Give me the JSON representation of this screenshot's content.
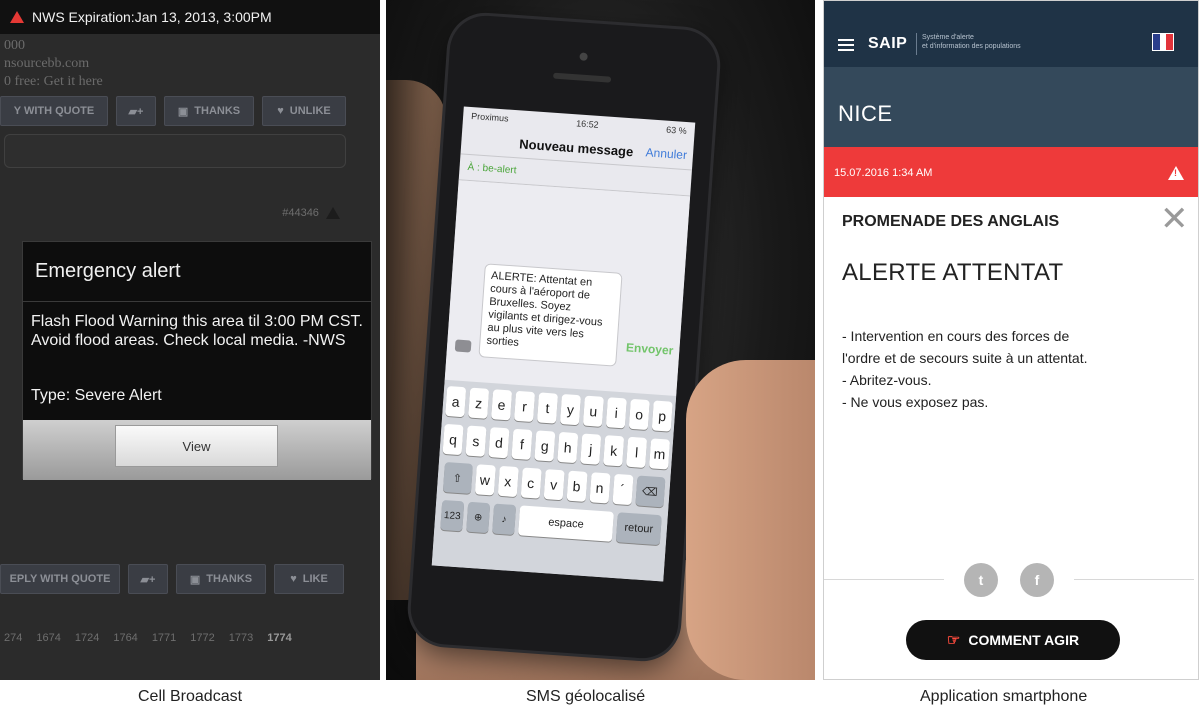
{
  "captions": {
    "left": "Cell Broadcast",
    "middle": "SMS géolocalisé",
    "right": "Application smartphone"
  },
  "cell_broadcast": {
    "status_text": "NWS  Expiration:Jan 13, 2013, 3:00PM",
    "forum_lines": [
      "000",
      "nsourcebb.com",
      "0 free: Get it here"
    ],
    "buttons_top": [
      "Y WITH QUOTE",
      "THANKS",
      "UNLIKE"
    ],
    "buttons_bottom": [
      "EPLY WITH QUOTE",
      "THANKS",
      "LIKE"
    ],
    "post_number": "#44346",
    "pager": [
      "274",
      "1674",
      "1724",
      "1764",
      "1771",
      "1772",
      "1773",
      "1774"
    ],
    "dialog": {
      "title": "Emergency alert",
      "body": "Flash Flood Warning this area til 3:00 PM CST. Avoid flood areas. Check local media. -NWS",
      "type": "Type: Severe Alert",
      "button": "View"
    }
  },
  "sms": {
    "carrier": "Proximus",
    "time": "16:52",
    "battery": "63 %",
    "nav_title": "Nouveau message",
    "cancel": "Annuler",
    "to": "À : be-alert",
    "message": "ALERTE: Attentat en cours à l'aéroport de Bruxelles. Soyez vigilants et dirigez-vous au plus vite vers les sorties",
    "send": "Envoyer",
    "keys_row1": [
      "a",
      "z",
      "e",
      "r",
      "t",
      "y",
      "u",
      "i",
      "o",
      "p"
    ],
    "keys_row2": [
      "q",
      "s",
      "d",
      "f",
      "g",
      "h",
      "j",
      "k",
      "l",
      "m"
    ],
    "keys_row3": [
      "w",
      "x",
      "c",
      "v",
      "b",
      "n",
      "´"
    ],
    "key_123": "123",
    "key_space": "espace",
    "key_return": "retour"
  },
  "app": {
    "logo": "SAIP",
    "subtitle_line1": "Système d'alerte",
    "subtitle_line2": "et d'information des populations",
    "city": "NICE",
    "timestamp": "15.07.2016 1:34 AM",
    "place": "PROMENADE DES ANGLAIS",
    "headline": "ALERTE ATTENTAT",
    "body_lines": [
      "- Intervention en cours des forces de",
      "l'ordre et de secours suite à un attentat.",
      "- Abritez-vous.",
      "- Ne vous exposez pas."
    ],
    "twitter": "t",
    "facebook": "f",
    "action_button": "COMMENT AGIR"
  },
  "colors": {
    "saip_header": "#1f3346",
    "saip_city": "#34495b",
    "saip_alert": "#ee3a3a",
    "sms_send": "#72c46a",
    "sms_cancel": "#3f7bd9"
  }
}
